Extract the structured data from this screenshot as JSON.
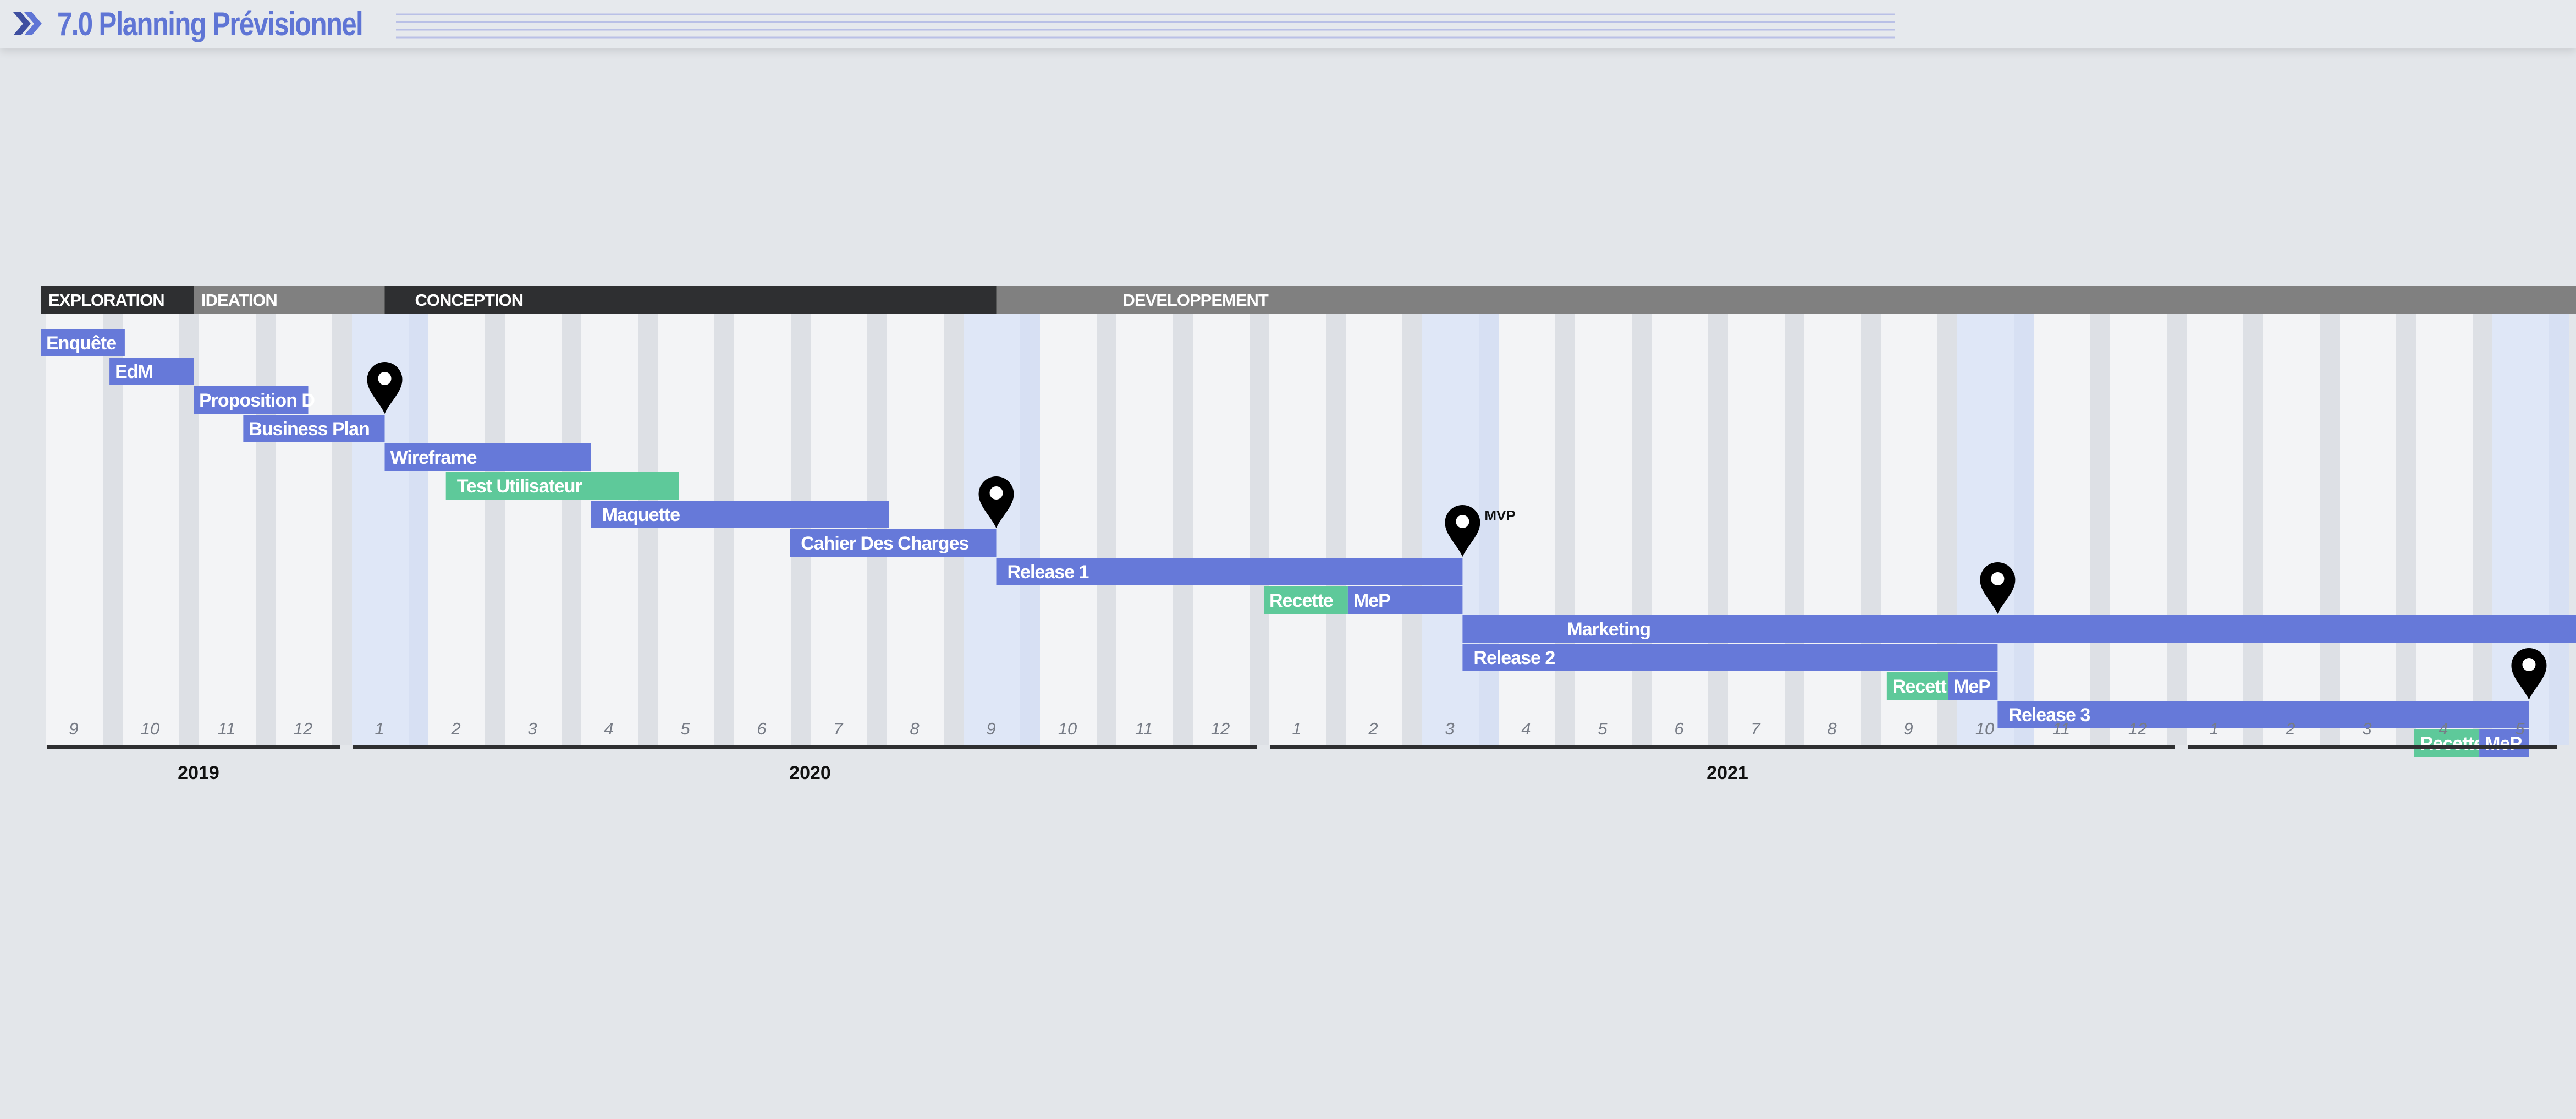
{
  "header": {
    "title": "7.0 Planning Prévisionnel",
    "icon": "double-chevron-right-icon",
    "accent": "#5f75d5"
  },
  "colors": {
    "task": "#6679d9",
    "test": "#5ec99a",
    "phase_dark": "#2e2f31",
    "phase_gray": "#808080",
    "highlight": "#dfe7f7",
    "milestone": "#000000"
  },
  "timeline": {
    "start": "2019-09",
    "months": [
      "9",
      "10",
      "11",
      "12",
      "1",
      "2",
      "3",
      "4",
      "5",
      "6",
      "7",
      "8",
      "9",
      "10",
      "11",
      "12",
      "1",
      "2",
      "3",
      "4",
      "5",
      "6",
      "7",
      "8",
      "9",
      "10",
      "11",
      "12",
      "1",
      "2",
      "3",
      "4",
      "5"
    ],
    "highlight_months": [
      4,
      12,
      18,
      25,
      32
    ],
    "red_month": 12,
    "years": [
      {
        "label": "2019",
        "start": 0,
        "end": 4
      },
      {
        "label": "2020",
        "start": 4,
        "end": 16
      },
      {
        "label": "2021",
        "start": 16,
        "end": 28
      },
      {
        "label": "",
        "start": 28,
        "end": 33
      }
    ]
  },
  "phases": [
    {
      "label": "EXPLORATION",
      "start": 0,
      "end": 2,
      "tone": "dark"
    },
    {
      "label": "IDEATION",
      "start": 2,
      "end": 4.5,
      "tone": "gray"
    },
    {
      "label": "CONCEPTION",
      "start": 4.5,
      "end": 12.5,
      "tone": "dark"
    },
    {
      "label": "DEVELOPPEMENT",
      "start": 12.5,
      "end": 33.5,
      "tone": "gray"
    }
  ],
  "tasks": [
    {
      "label": "Enquête",
      "start": 0,
      "end": 1.1,
      "row": 0,
      "type": "task"
    },
    {
      "label": "EdM",
      "start": 0.9,
      "end": 2,
      "row": 1,
      "type": "task"
    },
    {
      "label": "Proposition D",
      "start": 2,
      "end": 3.5,
      "row": 2,
      "type": "task"
    },
    {
      "label": "Business Plan",
      "start": 2.65,
      "end": 4.5,
      "row": 3,
      "type": "task"
    },
    {
      "label": "Wireframe",
      "start": 4.5,
      "end": 7.2,
      "row": 4,
      "type": "task"
    },
    {
      "label": "Test Utilisateur",
      "start": 5.3,
      "end": 8.35,
      "row": 5,
      "type": "test"
    },
    {
      "label": "Maquette",
      "start": 7.2,
      "end": 11.1,
      "row": 6,
      "type": "task"
    },
    {
      "label": "Cahier Des Charges",
      "start": 9.8,
      "end": 12.5,
      "row": 7,
      "type": "task"
    },
    {
      "label": "Release 1",
      "start": 12.5,
      "end": 18.6,
      "row": 8,
      "type": "task"
    },
    {
      "label": "Recette",
      "start": 16,
      "end": 17.1,
      "row": 9,
      "type": "test"
    },
    {
      "label": "MeP",
      "start": 17.1,
      "end": 18.6,
      "row": 9,
      "type": "task"
    },
    {
      "label": "Marketing",
      "start": 18.6,
      "end": 33.5,
      "row": 10,
      "type": "task"
    },
    {
      "label": "Release 2",
      "start": 18.6,
      "end": 25.6,
      "row": 11,
      "type": "task"
    },
    {
      "label": "Recett",
      "start": 24.15,
      "end": 24.95,
      "row": 12,
      "type": "test"
    },
    {
      "label": "MeP",
      "start": 24.95,
      "end": 25.6,
      "row": 12,
      "type": "task"
    },
    {
      "label": "Release 3",
      "start": 25.6,
      "end": 32.55,
      "row": 13,
      "type": "task"
    },
    {
      "label": "Recette",
      "start": 31.05,
      "end": 31.9,
      "row": 14,
      "type": "test"
    },
    {
      "label": "MeP",
      "start": 31.9,
      "end": 32.55,
      "row": 14,
      "type": "task"
    }
  ],
  "milestones": [
    {
      "at": 4.5,
      "row": 2,
      "label": ""
    },
    {
      "at": 12.5,
      "row": 6,
      "label": ""
    },
    {
      "at": 18.6,
      "row": 7,
      "label": "MVP"
    },
    {
      "at": 25.6,
      "row": 9,
      "label": ""
    },
    {
      "at": 32.55,
      "row": 12,
      "label": ""
    }
  ]
}
